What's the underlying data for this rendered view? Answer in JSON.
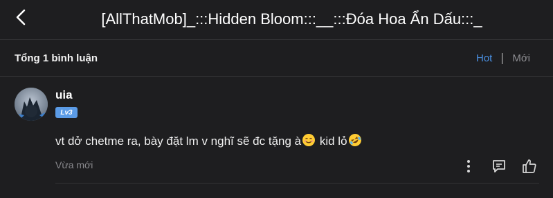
{
  "header": {
    "title": "[AllThatMob]_:::Hidden Bloom:::__:::Đóa Hoa Ẩn Dấu:::_",
    "back_icon": "chevron-left-icon"
  },
  "summary": {
    "count_label": "Tổng 1 bình luận",
    "sort_hot": "Hot",
    "sort_new": "Mới",
    "active_sort_color": "#4a90e2"
  },
  "comments": [
    {
      "username": "uia",
      "level": "Lv3",
      "text_parts": [
        "vt dở chetme ra, bày đặt lm v nghĩ sẽ đc tặng à",
        " kid lỏ"
      ],
      "emojis": [
        "smiling-face-emoji",
        "rolling-on-floor-laughing-emoji"
      ],
      "time": "Vừa mới",
      "actions": [
        "more-vertical-icon",
        "reply-icon",
        "like-icon"
      ]
    }
  ]
}
